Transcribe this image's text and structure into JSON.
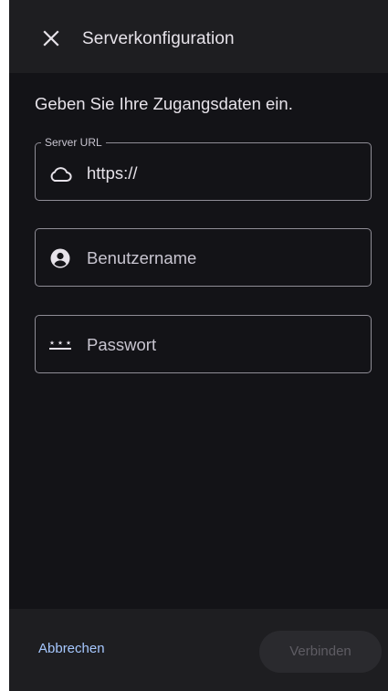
{
  "dialog": {
    "title": "Serverkonfiguration",
    "close_icon": "close-icon",
    "heading": "Geben Sie Ihre Zugangsdaten ein."
  },
  "fields": {
    "server_url": {
      "label": "Server URL",
      "value": "https://",
      "icon": "cloud-icon"
    },
    "username": {
      "placeholder": "Benutzername",
      "icon": "account-circle-icon"
    },
    "password": {
      "placeholder": "Passwort",
      "icon": "password-icon"
    }
  },
  "actions": {
    "cancel_label": "Abbrechen",
    "connect_label": "Verbinden",
    "connect_enabled": false
  },
  "colors": {
    "background": "#131317",
    "bar": "#1e1e21",
    "text": "#e6e2e9",
    "outline": "#8f8d96",
    "accent": "#a6c8ff",
    "disabled_text": "#5e5c63"
  }
}
